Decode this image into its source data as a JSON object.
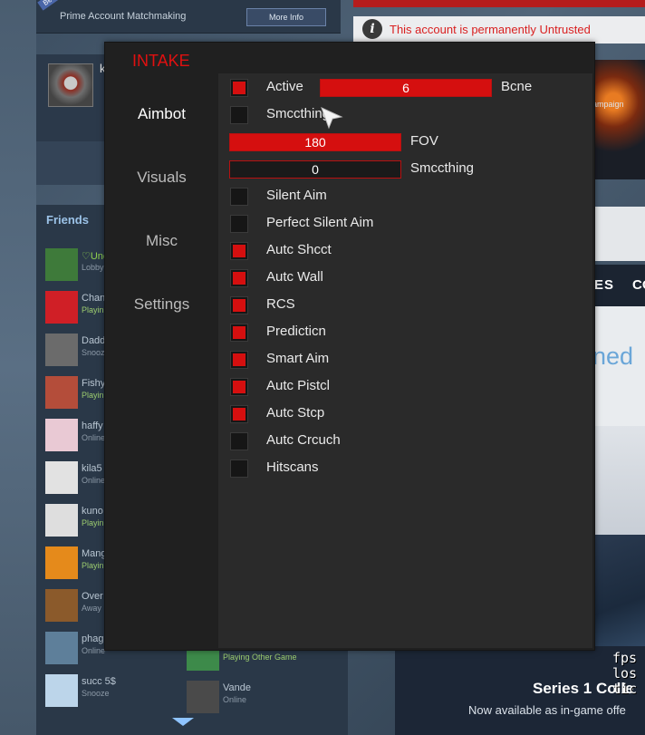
{
  "background": {
    "prime_bar": {
      "beta": "Beta",
      "text": "Prime Account Matchmaking",
      "more_info": "More Info"
    },
    "untrusted": {
      "info_glyph": "i",
      "text": "This account is permanently Untrusted"
    },
    "profile": {
      "name_initial": "k"
    },
    "campaign": "ampaign",
    "nav": {
      "item1": "ES",
      "item2": "CO"
    },
    "ned": "ned",
    "friends": {
      "title": "Friends",
      "list": [
        {
          "name": "♡Unc",
          "status": "Lobby",
          "online": true,
          "color": "#3e7a3a"
        },
        {
          "name": "Chan",
          "status": "Playin",
          "playing": true,
          "color": "#d01f26"
        },
        {
          "name": "Dadd",
          "status": "Snooz",
          "color": "#6b6b6b"
        },
        {
          "name": "Fishy",
          "status": "Playin",
          "playing": true,
          "color": "#b44d3a"
        },
        {
          "name": "haffy",
          "status": "Online",
          "color": "#e9c9d4"
        },
        {
          "name": "kila5",
          "status": "Online",
          "color": "#e2e2e2"
        },
        {
          "name": "kuno",
          "status": "Playin",
          "playing": true,
          "color": "#dedede"
        },
        {
          "name": "Mang",
          "status": "Playin",
          "playing": true,
          "color": "#e58a1b"
        },
        {
          "name": "Over",
          "status": "Away",
          "color": "#8b5a2b"
        },
        {
          "name": "phag",
          "status": "Online",
          "color": "#5e7f9a"
        },
        {
          "name": "succ 5$",
          "status": "Snooze",
          "color": "#bcd5ea"
        }
      ],
      "col2": [
        {
          "name": "",
          "status": "Playing Other Game",
          "playing": true,
          "color": "#3d8a4a"
        },
        {
          "name": "Vande",
          "status": "Online",
          "color": "#4a4a4a"
        }
      ]
    },
    "series": {
      "title": "Series 1 Colle",
      "subtitle": "Now available as in-game offe"
    },
    "netgraph": "fps\nlos\ntic"
  },
  "menu": {
    "title": "INTAKE",
    "accent": "#d50f0f",
    "tabs": [
      {
        "label": "Aimbot",
        "active": true
      },
      {
        "label": "Visuals",
        "active": false
      },
      {
        "label": "Misc",
        "active": false
      },
      {
        "label": "Settings",
        "active": false
      }
    ],
    "active_toggle": {
      "label": "Active",
      "checked": true
    },
    "bone_slider": {
      "value": "6",
      "label": "Bcne"
    },
    "smoothing_toggle": {
      "label": "Smccthing",
      "checked": false
    },
    "fov_slider": {
      "value": "180",
      "label": "FOV"
    },
    "smoothing_slider": {
      "value": "0",
      "label": "Smccthing"
    },
    "options": [
      {
        "label": "Silent Aim",
        "checked": false
      },
      {
        "label": "Perfect Silent Aim",
        "checked": false
      },
      {
        "label": "Autc Shcct",
        "checked": true
      },
      {
        "label": "Autc Wall",
        "checked": true
      },
      {
        "label": "RCS",
        "checked": true
      },
      {
        "label": "Predicticn",
        "checked": true
      },
      {
        "label": "Smart Aim",
        "checked": true
      },
      {
        "label": "Autc Pistcl",
        "checked": true
      },
      {
        "label": "Autc Stcp",
        "checked": true
      },
      {
        "label": "Autc Crcuch",
        "checked": false
      },
      {
        "label": "Hitscans",
        "checked": false
      }
    ]
  }
}
